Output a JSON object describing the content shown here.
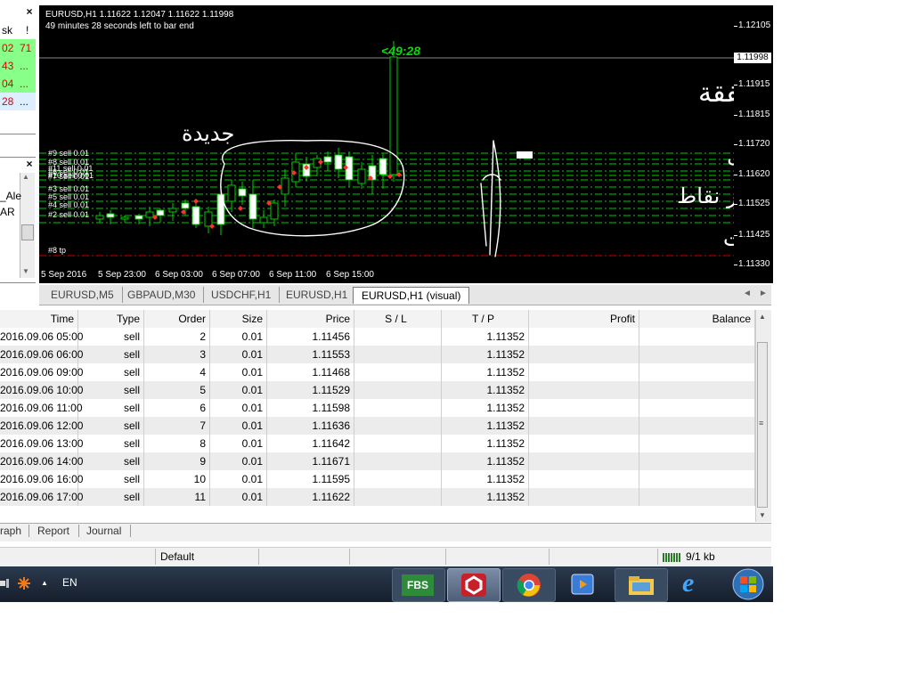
{
  "market_watch": {
    "close": "×",
    "col_ask": "sk",
    "col_excl": "!",
    "rows": [
      {
        "ask": "02",
        "spread": "71",
        "bg": "#88ff88",
        "askcolor": "#e00000",
        "spreadcolor": "#e00000"
      },
      {
        "ask": "43",
        "spread": "...",
        "bg": "#88ff88",
        "askcolor": "#e00000",
        "spreadcolor": "#e00000"
      },
      {
        "ask": "04",
        "spread": "...",
        "bg": "#88ff88",
        "askcolor": "#e00000",
        "spreadcolor": "#e00000"
      },
      {
        "ask": "28",
        "spread": "...",
        "bg": "#ddeeff",
        "askcolor": "#e00000",
        "spreadcolor": "#0000c0"
      }
    ]
  },
  "navigator": {
    "close": "×",
    "items": [
      "_Ale",
      "AR"
    ],
    "scroll_up": "▲",
    "scroll_down": "▼"
  },
  "chart": {
    "header_line1": "EURUSD,H1  1.11622 1.12047 1.11622 1.11998",
    "header_line2": "49 minutes 28 seconds left to bar end",
    "timer": "<49:28",
    "current_price": "1.11998",
    "price_labels": [
      "1.12105",
      "1.11915",
      "1.11815",
      "1.11720",
      "1.11620",
      "1.11525",
      "1.11425",
      "1.11330"
    ],
    "time_labels": [
      "5 Sep 2016",
      "5 Sep 23:00",
      "6 Sep 03:00",
      "6 Sep 07:00",
      "6 Sep 11:00",
      "6 Sep 15:00"
    ],
    "order_labels": [
      "#9 sell 0.01",
      "#8 sell 0.01",
      "#11 sell 0.01",
      "#10 sell 0.01",
      "#3 sell 0.01",
      "#5 sell 0.01",
      "#4 sell 0.01",
      "#2 sell 0.01",
      "#6 sell 0.01",
      "#7 sell 0.01"
    ],
    "tp_label": "#8 tp",
    "annotation_line1": "المفروض نقل الاستوب خطة على كل صفقة",
    "annotation_line2": "جديدة",
    "annotation_line3": "لسى المفروض نقل",
    "annotation_line4": "نقرب عشر نقاط",
    "annotation_line5": "على الصفقات",
    "colors": {
      "bg": "#000000",
      "order_line": "#00cc00",
      "tp_line": "#cc0000",
      "candle": "#00cc00",
      "text": "#ffffff",
      "timer": "#00e000"
    }
  },
  "chart_tabs": {
    "tabs": [
      "EURUSD,M5",
      "GBPAUD,M30",
      "USDCHF,H1",
      "EURUSD,H1",
      "EURUSD,H1 (visual)"
    ],
    "active": 4,
    "prev": "◄",
    "next": "►"
  },
  "orders_table": {
    "columns": [
      "Time",
      "Type",
      "Order",
      "Size",
      "Price",
      "S / L",
      "T / P",
      "Profit",
      "Balance"
    ],
    "rows": [
      [
        "2016.09.06 05:00",
        "sell",
        "2",
        "0.01",
        "1.11456",
        "",
        "1.11352",
        "",
        ""
      ],
      [
        "2016.09.06 06:00",
        "sell",
        "3",
        "0.01",
        "1.11553",
        "",
        "1.11352",
        "",
        ""
      ],
      [
        "2016.09.06 09:00",
        "sell",
        "4",
        "0.01",
        "1.11468",
        "",
        "1.11352",
        "",
        ""
      ],
      [
        "2016.09.06 10:00",
        "sell",
        "5",
        "0.01",
        "1.11529",
        "",
        "1.11352",
        "",
        ""
      ],
      [
        "2016.09.06 11:00",
        "sell",
        "6",
        "0.01",
        "1.11598",
        "",
        "1.11352",
        "",
        ""
      ],
      [
        "2016.09.06 12:00",
        "sell",
        "7",
        "0.01",
        "1.11636",
        "",
        "1.11352",
        "",
        ""
      ],
      [
        "2016.09.06 13:00",
        "sell",
        "8",
        "0.01",
        "1.11642",
        "",
        "1.11352",
        "",
        ""
      ],
      [
        "2016.09.06 14:00",
        "sell",
        "9",
        "0.01",
        "1.11671",
        "",
        "1.11352",
        "",
        ""
      ],
      [
        "2016.09.06 16:00",
        "sell",
        "10",
        "0.01",
        "1.11595",
        "",
        "1.11352",
        "",
        ""
      ],
      [
        "2016.09.06 17:00",
        "sell",
        "11",
        "0.01",
        "1.11622",
        "",
        "1.11352",
        "",
        ""
      ]
    ],
    "scroll_up": "▲",
    "scroll_down": "▼",
    "scroll_grip": "≡"
  },
  "terminal_tabs": {
    "tabs": [
      "raph",
      "Report",
      "Journal"
    ]
  },
  "status_bar": {
    "profile": "Default",
    "connection": "9/1 kb"
  },
  "taskbar": {
    "lang": "EN",
    "up_arrow": "▲",
    "apps": [
      {
        "name": "FBS",
        "label": "FBS"
      },
      {
        "name": "terminal",
        "label": ""
      },
      {
        "name": "chrome",
        "label": ""
      },
      {
        "name": "media-player",
        "label": ""
      },
      {
        "name": "file-explorer",
        "label": ""
      },
      {
        "name": "internet-explorer",
        "label": "e"
      },
      {
        "name": "windows-start",
        "label": ""
      }
    ]
  }
}
